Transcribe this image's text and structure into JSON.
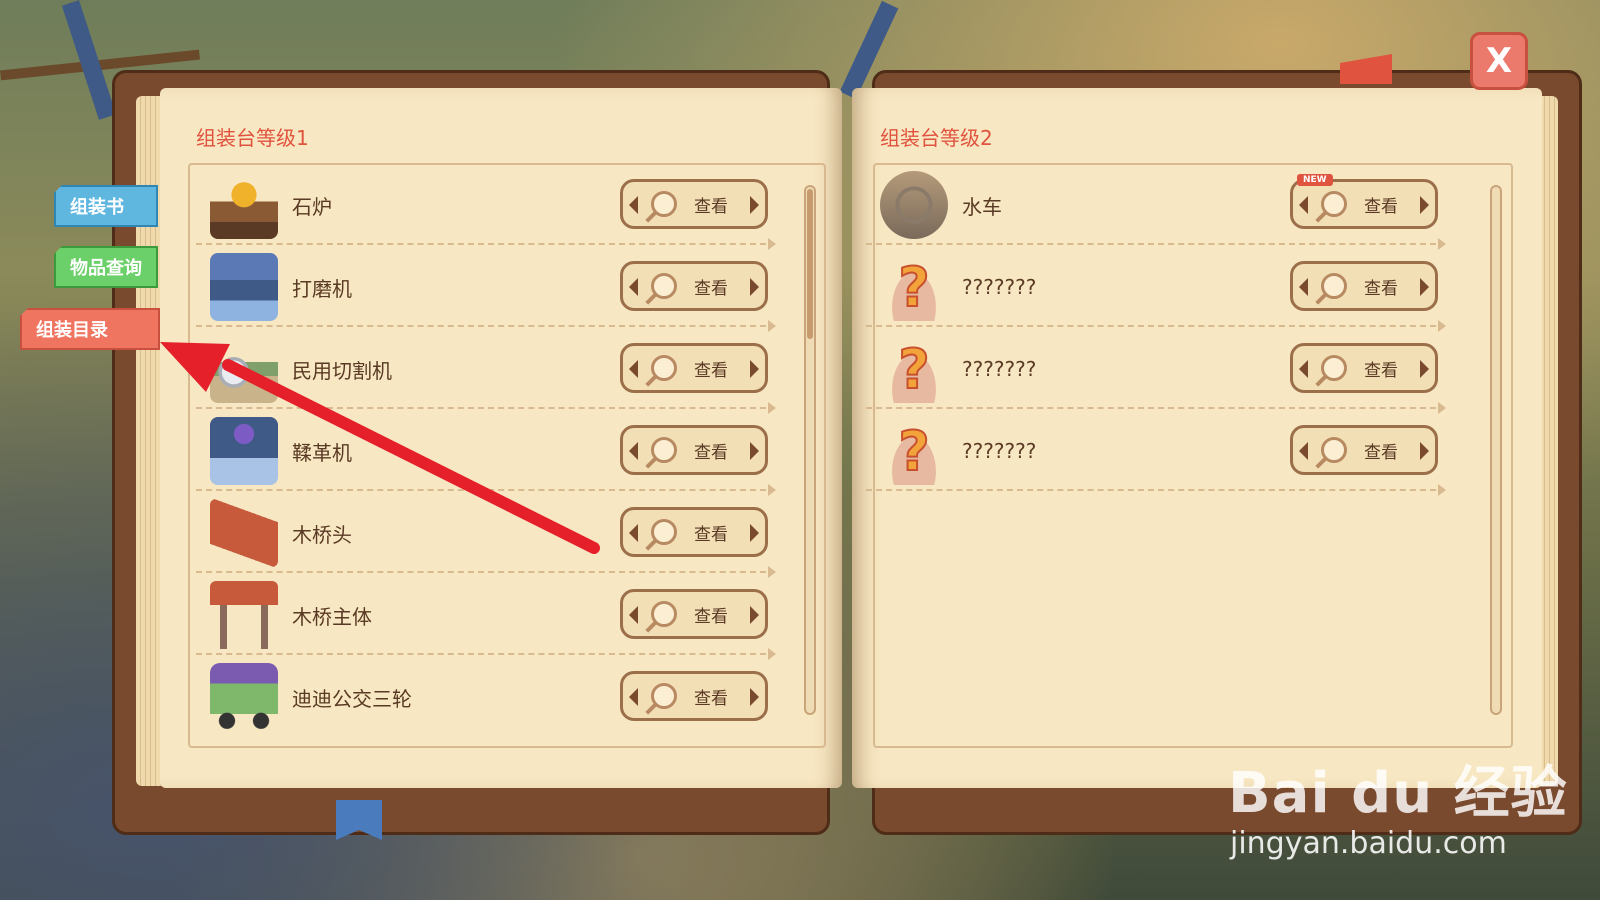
{
  "tabs": {
    "book": "组装书",
    "query": "物品查询",
    "catalog": "组装目录"
  },
  "close_label": "X",
  "left_page": {
    "title": "组装台等级1",
    "items": [
      {
        "name": "石炉",
        "icon": "stone-furnace-icon",
        "view": "查看"
      },
      {
        "name": "打磨机",
        "icon": "grinder-icon",
        "view": "查看"
      },
      {
        "name": "民用切割机",
        "icon": "cutter-icon",
        "view": "查看"
      },
      {
        "name": "鞣革机",
        "icon": "tanner-icon",
        "view": "查看"
      },
      {
        "name": "木桥头",
        "icon": "wooden-bridge-head-icon",
        "view": "查看"
      },
      {
        "name": "木桥主体",
        "icon": "wooden-bridge-body-icon",
        "view": "查看"
      },
      {
        "name": "迪迪公交三轮",
        "icon": "tuk-tuk-icon",
        "view": "查看"
      }
    ]
  },
  "right_page": {
    "title": "组装台等级2",
    "items": [
      {
        "name": "水车",
        "icon": "water-wheel-icon",
        "view": "查看",
        "badge": "NEW"
      },
      {
        "name": "???????",
        "icon": "unknown-icon",
        "view": "查看"
      },
      {
        "name": "???????",
        "icon": "unknown-icon",
        "view": "查看"
      },
      {
        "name": "???????",
        "icon": "unknown-icon",
        "view": "查看"
      }
    ]
  },
  "watermark": {
    "logo": "Bai du 经验",
    "url": "jingyan.baidu.com"
  },
  "colors": {
    "title_red": "#e0533e",
    "page": "#f7e7c2",
    "cover": "#7a4a2e",
    "arrow": "#e5202a"
  }
}
